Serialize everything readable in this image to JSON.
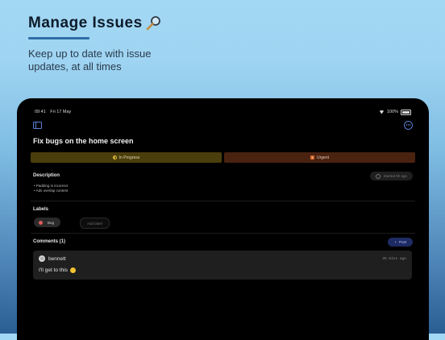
{
  "hero": {
    "title": "Manage Issues",
    "subtitle": "Keep up to date with issue updates, at all times"
  },
  "status_bar": {
    "time": "09:41",
    "date": "Fri 17 May",
    "battery": "100%"
  },
  "issue": {
    "title": "Fix bugs on the home screen",
    "status": "In Progress",
    "priority": "Urgent",
    "priority_icon": "!"
  },
  "description": {
    "label": "Description",
    "started": "Started 9h ago",
    "lines": [
      "• Padding is incorrect",
      "• Ads overlap content"
    ]
  },
  "labels": {
    "label": "Labels",
    "items": [
      "Bug"
    ],
    "add_label": "Add label"
  },
  "comments": {
    "label": "Comments (1)",
    "post": "Post",
    "items": [
      {
        "author": "bennett",
        "time": "35 mins ago",
        "text": "I'll get to this"
      }
    ]
  },
  "colors": {
    "accent": "#5b7fd6",
    "status_in_progress": "#e0b93a",
    "priority_urgent": "#d36b2a",
    "label_bug": "#e05a5a"
  }
}
